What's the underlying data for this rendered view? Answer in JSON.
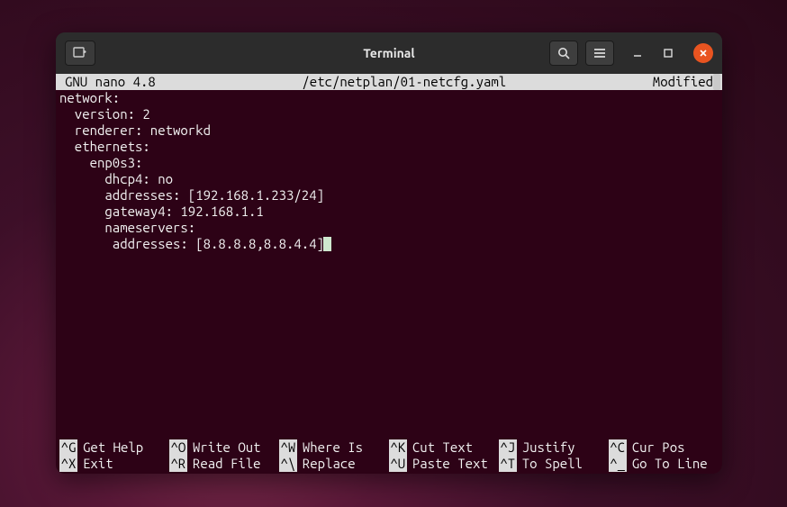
{
  "window": {
    "title": "Terminal"
  },
  "nano": {
    "header_left": "GNU nano 4.8",
    "header_center": "/etc/netplan/01-netcfg.yaml",
    "header_right": "Modified",
    "content_lines": [
      "network:",
      "  version: 2",
      "  renderer: networkd",
      "  ethernets:",
      "    enp0s3:",
      "      dhcp4: no",
      "      addresses: [192.168.1.233/24]",
      "      gateway4: 192.168.1.1",
      "      nameservers:",
      "       addresses: [8.8.8.8,8.8.4.4]"
    ],
    "shortcuts": {
      "row1": [
        {
          "key": "^G",
          "label": "Get Help"
        },
        {
          "key": "^O",
          "label": "Write Out"
        },
        {
          "key": "^W",
          "label": "Where Is"
        },
        {
          "key": "^K",
          "label": "Cut Text"
        },
        {
          "key": "^J",
          "label": "Justify"
        },
        {
          "key": "^C",
          "label": "Cur Pos"
        }
      ],
      "row2": [
        {
          "key": "^X",
          "label": "Exit"
        },
        {
          "key": "^R",
          "label": "Read File"
        },
        {
          "key": "^\\",
          "label": "Replace"
        },
        {
          "key": "^U",
          "label": "Paste Text"
        },
        {
          "key": "^T",
          "label": "To Spell"
        },
        {
          "key": "^_",
          "label": "Go To Line"
        }
      ]
    }
  }
}
